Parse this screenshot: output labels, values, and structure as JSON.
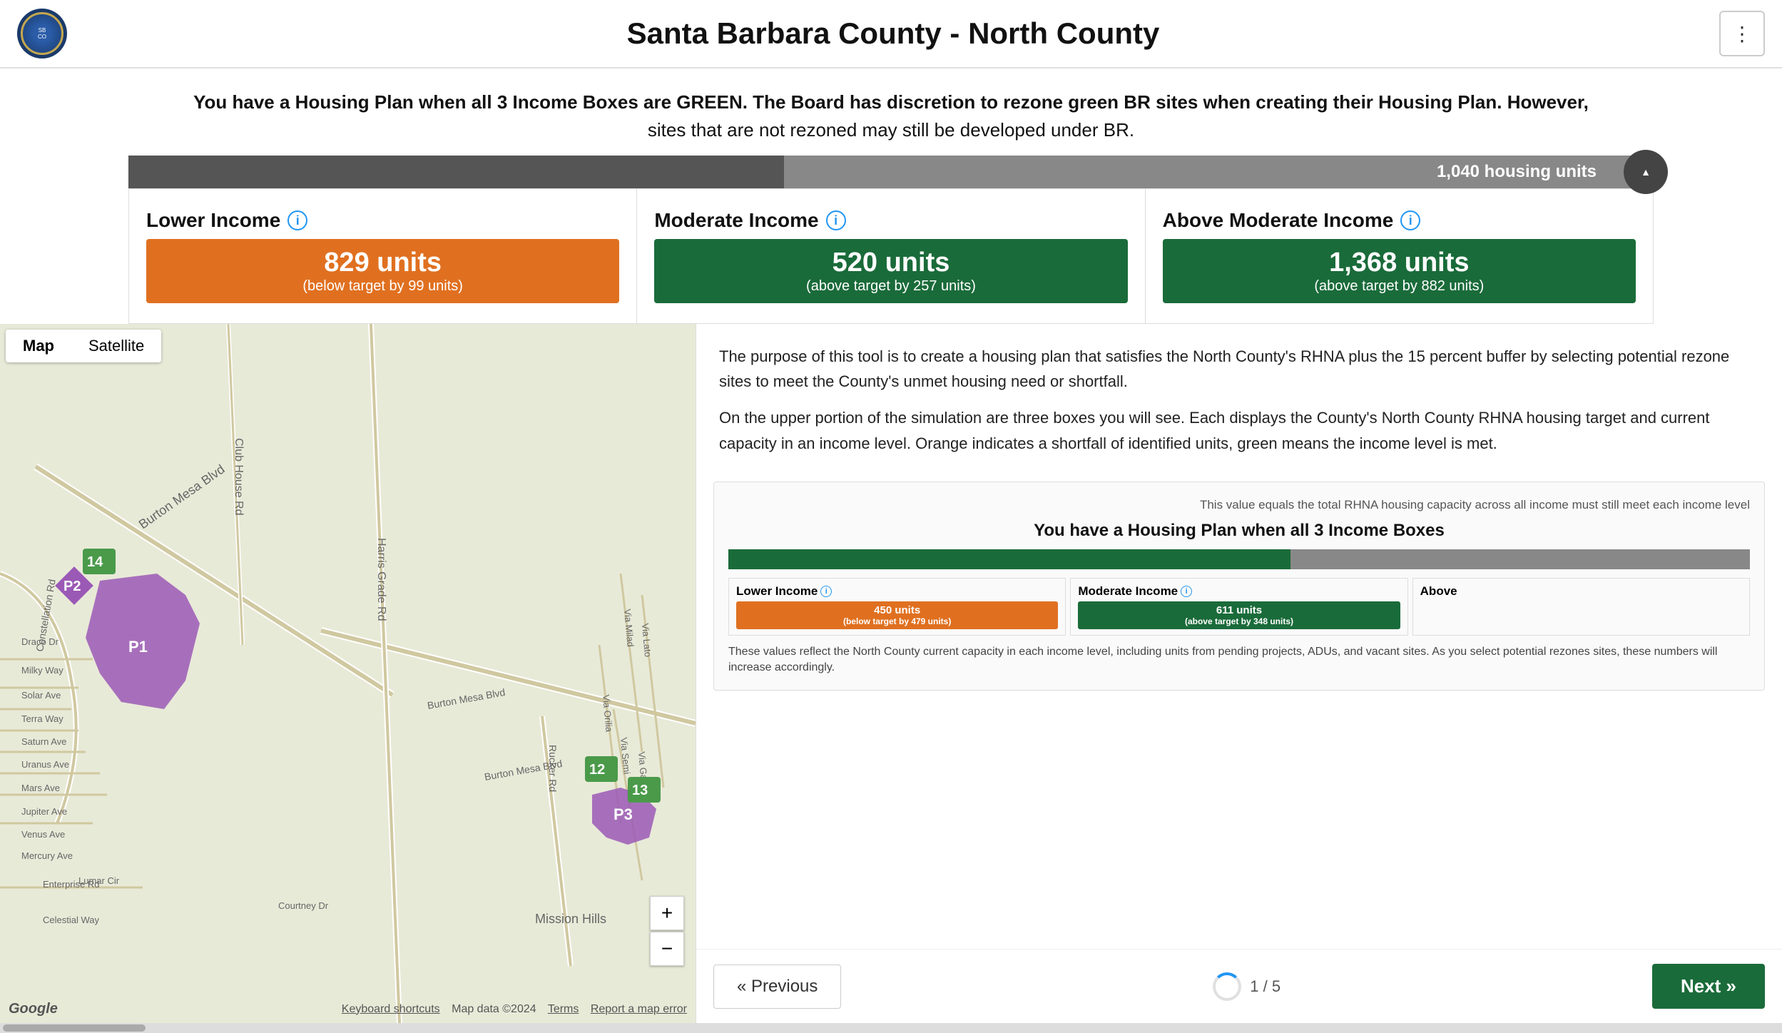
{
  "header": {
    "title": "Santa Barbara County - North County",
    "menu_icon": "⋮"
  },
  "info_banner": {
    "line1": "You have a Housing Plan when all 3 Income Boxes are GREEN. The Board has discretion to rezone green BR sites when creating their Housing Plan. However,",
    "line2": "sites that are not rezoned may still be developed under BR."
  },
  "progress_bar": {
    "label": "1,040 housing units"
  },
  "income_boxes": [
    {
      "label": "Lower Income",
      "units": "829 units",
      "sub": "(below target by 99 units)",
      "type": "orange"
    },
    {
      "label": "Moderate Income",
      "units": "520 units",
      "sub": "(above target by 257 units)",
      "type": "green"
    },
    {
      "label": "Above Moderate Income",
      "units": "1,368 units",
      "sub": "(above target by 882 units)",
      "type": "green"
    }
  ],
  "map": {
    "tab_map": "Map",
    "tab_satellite": "Satellite",
    "zoom_in": "+",
    "zoom_out": "−",
    "footer": {
      "keyboard": "Keyboard shortcuts",
      "data": "Map data ©2024",
      "terms": "Terms",
      "report": "Report a map error"
    },
    "google_label": "Google"
  },
  "info_panel": {
    "paragraph1": "The purpose of this tool is to create a housing plan that satisfies the North County's RHNA plus the 15 percent buffer by selecting potential rezone sites to meet the County's unmet housing need or shortfall.",
    "paragraph2": "On the upper portion of the simulation are three boxes you will see. Each displays the County's North County RHNA housing target and current capacity in an income level. Orange indicates a shortfall of identified units, green means the income level is met.",
    "mini_note": "This value equals the total RHNA housing capacity across all income must still meet each income level",
    "mini_title": "You have a Housing Plan when all 3 Income Boxes",
    "mini_income": [
      {
        "label": "Lower Income",
        "units": "450 units",
        "sub": "(below target by 479 units)",
        "type": "orange"
      },
      {
        "label": "Moderate Income",
        "units": "611 units",
        "sub": "(above target by 348 units)",
        "type": "green"
      },
      {
        "label": "Above",
        "units": "",
        "sub": "",
        "type": "none"
      }
    ],
    "mini_footer": "These values reflect the North County current capacity in each income level, including units from pending projects, ADUs, and vacant sites. As you select potential rezones sites, these numbers will increase accordingly.",
    "nav": {
      "prev_label": "« Previous",
      "page_label": "1 / 5",
      "next_label": "Next »"
    }
  },
  "bottom_scrollbar": {}
}
